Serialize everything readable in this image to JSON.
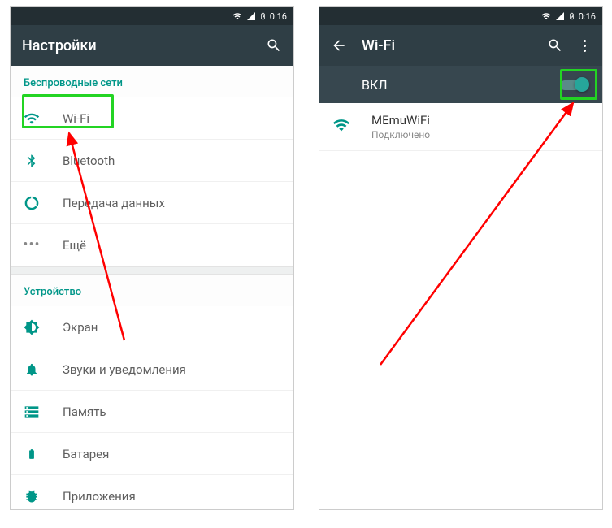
{
  "status": {
    "time": "0:16"
  },
  "left": {
    "title": "Настройки",
    "section1": "Беспроводные сети",
    "items1": {
      "wifi": "Wi-Fi",
      "bluetooth": "Bluetooth",
      "data": "Передача данных",
      "more": "Ещё"
    },
    "section2": "Устройство",
    "items2": {
      "display": "Экран",
      "sound": "Звуки и уведомления",
      "memory": "Память",
      "battery": "Батарея",
      "apps": "Приложения"
    }
  },
  "right": {
    "title": "Wi-Fi",
    "toggle_label": "ВКЛ",
    "network": {
      "name": "MEmuWiFi",
      "status": "Подключено"
    }
  }
}
